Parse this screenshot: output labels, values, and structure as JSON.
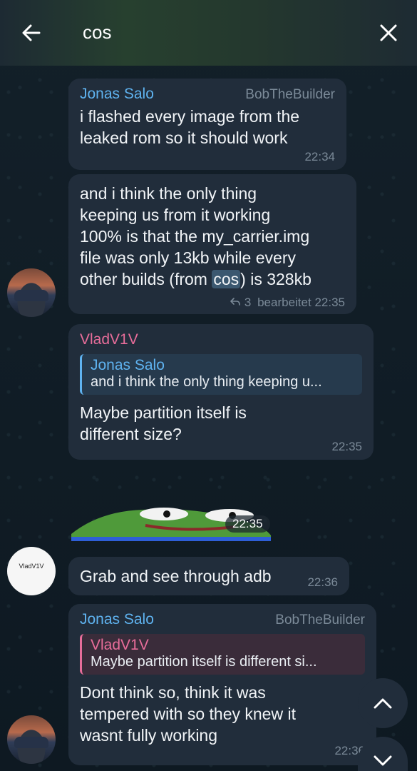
{
  "search": {
    "query": "cos"
  },
  "messages": [
    {
      "sender": "Jonas Salo",
      "tag": "BobTheBuilder",
      "lines": [
        "i flashed every image from the",
        "leaked rom so it should work"
      ],
      "time": "22:34"
    },
    {
      "lines": [
        "and i think the only thing",
        "keeping us from it working",
        "100% is that the my_carrier.img",
        "file was only 13kb while every"
      ],
      "last_line_pre": "other builds (from ",
      "last_line_hl": "cos",
      "last_line_post": ") is 328kb",
      "reply_count": "3",
      "edited": "bearbeitet",
      "time": "22:35"
    },
    {
      "sender": "VladV1V",
      "reply_name": "Jonas Salo",
      "reply_text": "and i think the only thing keeping u...",
      "lines": [
        "Maybe partition itself is",
        "different size?"
      ],
      "time": "22:35"
    },
    {
      "sticker_time": "22:35"
    },
    {
      "lines": [
        "Grab and see through adb"
      ],
      "time": "22:36"
    },
    {
      "sender": "Jonas Salo",
      "tag": "BobTheBuilder",
      "reply_name": "VladV1V",
      "reply_text": "Maybe partition itself is different si...",
      "lines": [
        "Dont think so, think it was",
        "tempered with so they knew it",
        "wasnt fully working"
      ],
      "time": "22:36"
    }
  ],
  "avatars": {
    "vlad_label": "VladV1V"
  },
  "colors": {
    "accent": "#5fb3f0",
    "pink": "#e86d9a",
    "bubble": "#212d3b"
  }
}
